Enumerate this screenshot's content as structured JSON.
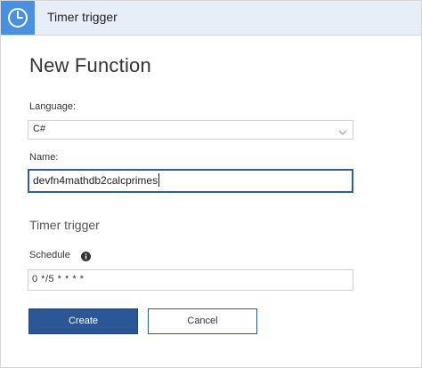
{
  "header": {
    "icon": "clock-icon",
    "title": "Timer trigger",
    "accent_color": "#4a90e2",
    "background_color": "#e8eef8"
  },
  "form": {
    "title": "New Function",
    "language": {
      "label": "Language:",
      "selected": "C#"
    },
    "name": {
      "label": "Name:",
      "value": "devfn4mathdb2calcprimes"
    },
    "section_title": "Timer trigger",
    "schedule": {
      "label": "Schedule",
      "info_icon": "info-icon",
      "value": "0 */5 * * * *"
    }
  },
  "actions": {
    "create_label": "Create",
    "cancel_label": "Cancel",
    "primary_color": "#2b5797"
  }
}
